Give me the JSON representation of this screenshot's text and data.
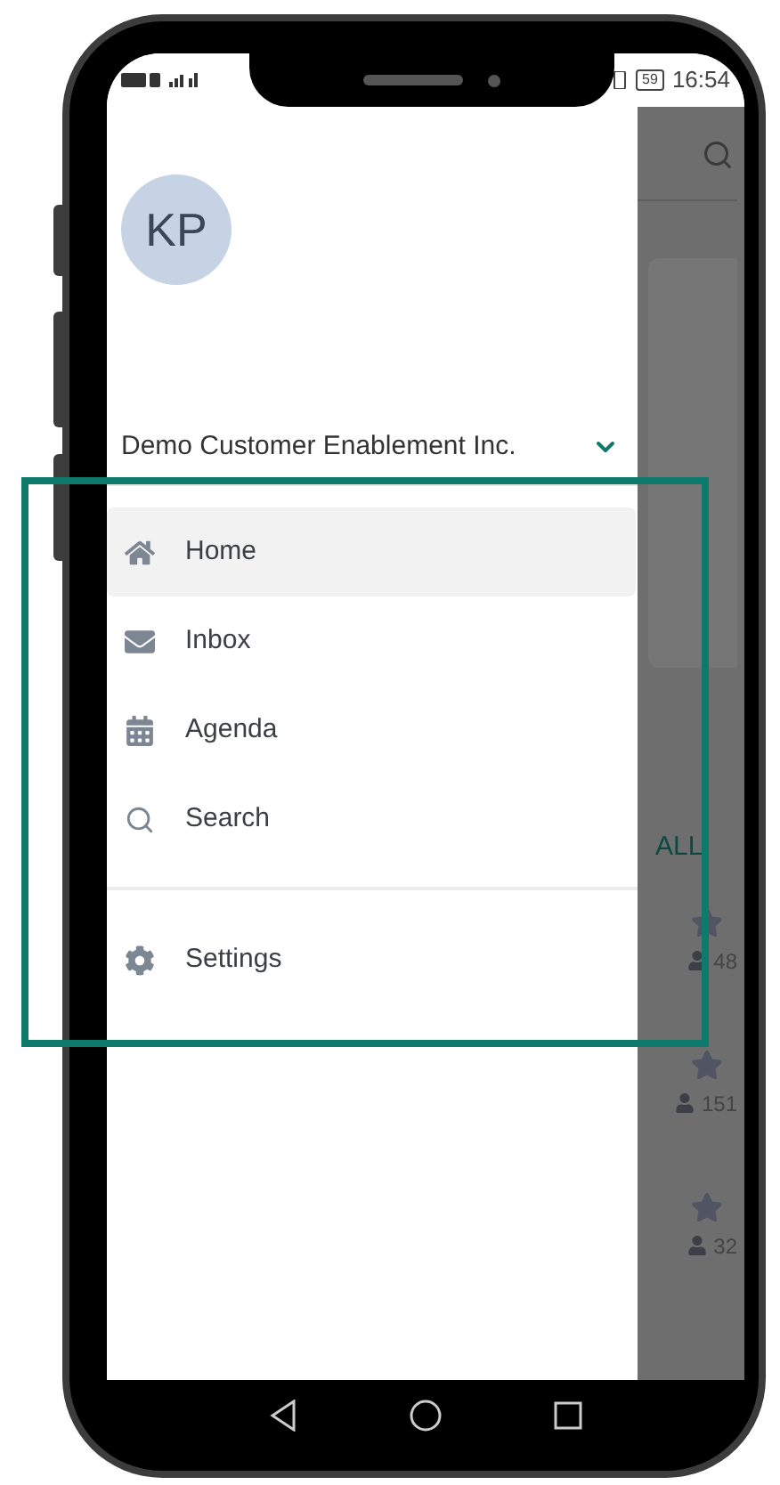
{
  "status_bar": {
    "time": "16:54",
    "battery": "59"
  },
  "drawer": {
    "avatar_initials": "KP",
    "organization": "Demo Customer Enablement Inc.",
    "items": [
      {
        "kind": "home",
        "label": "Home",
        "selected": true
      },
      {
        "kind": "inbox",
        "label": "Inbox",
        "selected": false
      },
      {
        "kind": "agenda",
        "label": "Agenda",
        "selected": false
      },
      {
        "kind": "search",
        "label": "Search",
        "selected": false
      }
    ],
    "footer_items": [
      {
        "kind": "settings",
        "label": "Settings",
        "selected": false
      }
    ]
  },
  "background": {
    "section_link": "ALL",
    "rows": [
      {
        "count": "48"
      },
      {
        "count": "151"
      },
      {
        "count": "32"
      }
    ]
  }
}
